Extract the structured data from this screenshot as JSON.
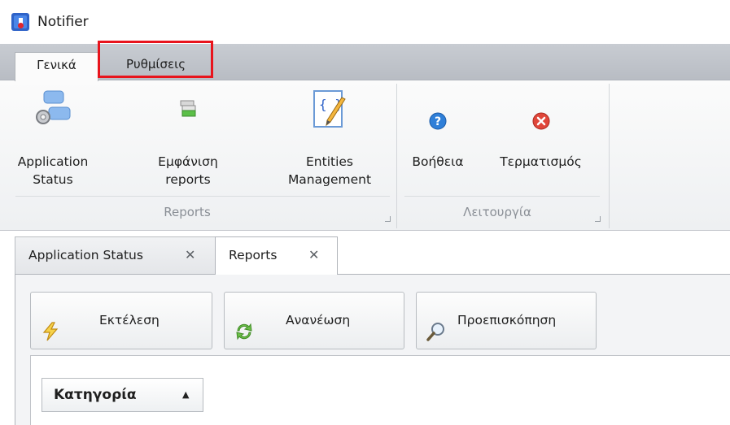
{
  "window": {
    "title": "Notifier",
    "icon": "notifier-app-icon"
  },
  "ribbon": {
    "tabs": [
      {
        "label": "Γενικά",
        "active": true
      },
      {
        "label": "Ρυθμίσεις",
        "active": false,
        "highlighted": true
      }
    ],
    "groups": [
      {
        "label": "Reports",
        "buttons": [
          {
            "label": "Application\nStatus",
            "icon": "application-status-icon"
          },
          {
            "label": "Εμφάνιση\nreports",
            "icon": "show-reports-icon"
          },
          {
            "label": "Entities\nManagement",
            "icon": "entities-management-icon"
          }
        ]
      },
      {
        "label": "Λειτουργία",
        "buttons": [
          {
            "label": "Βοήθεια",
            "icon": "help-icon"
          },
          {
            "label": "Τερματισμός",
            "icon": "exit-icon"
          }
        ]
      }
    ]
  },
  "document_tabs": [
    {
      "label": "Application Status",
      "active": false,
      "close": "✕"
    },
    {
      "label": "Reports",
      "active": true,
      "close": "✕"
    }
  ],
  "toolbar": {
    "execute_label": "Εκτέλεση",
    "refresh_label": "Ανανέωση",
    "preview_label": "Προεπισκόπηση"
  },
  "grid": {
    "column_header": "Κατηγορία",
    "sort_indicator": "▲"
  },
  "colors": {
    "highlight": "#e8141c",
    "ribbon_tabstrip": "#c0c4ca",
    "panel": "#f3f4f6"
  }
}
